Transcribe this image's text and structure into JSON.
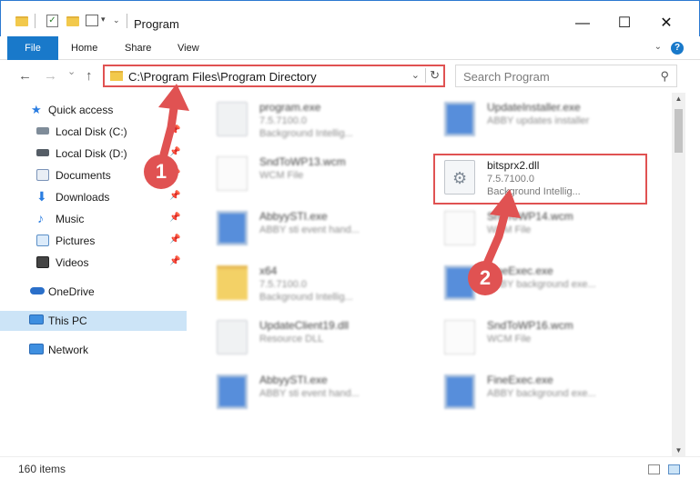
{
  "window": {
    "title": "Program",
    "minimize": "—",
    "maximize": "☐",
    "close": "✕"
  },
  "ribbon": {
    "tabs": [
      "File",
      "Home",
      "Share",
      "View"
    ],
    "collapse_icon": "chevron-down-icon",
    "help": "?"
  },
  "navigation": {
    "back": "←",
    "forward": "→",
    "recent": "⌄",
    "up": "↑",
    "address": "C:\\Program Files\\Program Directory",
    "search_placeholder": "Search Program"
  },
  "sidebar": {
    "items": [
      {
        "label": "Quick access",
        "icon": "star-icon",
        "pinned": false
      },
      {
        "label": "Local Disk (C:)",
        "icon": "drive-icon",
        "pinned": true
      },
      {
        "label": "Local Disk (D:)",
        "icon": "drive-icon",
        "pinned": true
      },
      {
        "label": "Documents",
        "icon": "documents-icon",
        "pinned": true
      },
      {
        "label": "Downloads",
        "icon": "download-icon",
        "pinned": true
      },
      {
        "label": "Music",
        "icon": "music-icon",
        "pinned": true
      },
      {
        "label": "Pictures",
        "icon": "pictures-icon",
        "pinned": true
      },
      {
        "label": "Videos",
        "icon": "videos-icon",
        "pinned": true
      },
      {
        "label": "OneDrive",
        "icon": "cloud-icon",
        "pinned": false
      },
      {
        "label": "This PC",
        "icon": "computer-icon",
        "pinned": false,
        "selected": true
      },
      {
        "label": "Network",
        "icon": "network-icon",
        "pinned": false
      }
    ]
  },
  "files": [
    {
      "name": "program.exe",
      "line1": "7.5.7100.0",
      "line2": "Background Intellig...",
      "icon": "exe-icon"
    },
    {
      "name": "UpdateInstaller.exe",
      "line1": "ABBY updates installer",
      "line2": "",
      "icon": "app-icon"
    },
    {
      "name": "SndToWP13.wcm",
      "line1": "WCM File",
      "line2": "",
      "icon": "document-icon"
    },
    {
      "name": "bitsprx2.dll",
      "line1": "7.5.7100.0",
      "line2": "Background Intellig...",
      "icon": "dll-gear-icon"
    },
    {
      "name": "AbbyySTI.exe",
      "line1": "ABBY sti event hand...",
      "line2": "",
      "icon": "app-icon"
    },
    {
      "name": "SndToWP14.wcm",
      "line1": "WCM File",
      "line2": "",
      "icon": "document-icon"
    },
    {
      "name": "x64",
      "line1": "7.5.7100.0",
      "line2": "Background Intellig...",
      "icon": "folder-icon"
    },
    {
      "name": "FineExec.exe",
      "line1": "ABBY background exe...",
      "line2": "",
      "icon": "app-icon"
    },
    {
      "name": "UpdateClient19.dll",
      "line1": "Resource DLL",
      "line2": "",
      "icon": "dll-gear-icon"
    },
    {
      "name": "SndToWP16.wcm",
      "line1": "WCM File",
      "line2": "",
      "icon": "document-icon"
    },
    {
      "name": "AbbyySTI.exe",
      "line1": "ABBY sti event hand...",
      "line2": "",
      "icon": "app-icon"
    },
    {
      "name": "FineExec.exe",
      "line1": "ABBY background exe...",
      "line2": "",
      "icon": "app-icon"
    }
  ],
  "markers": {
    "step1": "1",
    "step2": "2"
  },
  "status": {
    "items_count": "160 items"
  },
  "colors": {
    "accent": "#1979ca",
    "highlight": "#e05252",
    "selected_bg": "#cce4f7"
  }
}
